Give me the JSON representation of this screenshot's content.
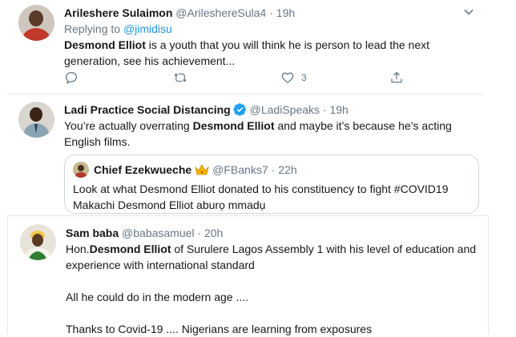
{
  "tweets": [
    {
      "name": "Arileshere Sulaimon",
      "handle": "@ArileshereSula4",
      "separator": "·",
      "time": "19h",
      "reply_prefix": "Replying to",
      "reply_to": "@jimidisu",
      "body_bold": "Desmond Elliot",
      "body_line1_rest": " is a youth that you will think he is person to lead the next",
      "body_line2": "generation, see his achievement...",
      "actions": {
        "reply_icon": "reply-icon",
        "retweet_icon": "retweet-icon",
        "like_icon": "heart-icon",
        "like_count": "3",
        "share_icon": "share-icon"
      }
    },
    {
      "name": "Ladi Practice Social Distancing",
      "handle": "@LadiSpeaks",
      "separator": "·",
      "time": "19h",
      "verified": true,
      "body_line1_pre": "You’re actually overrating ",
      "body_bold": "Desmond Elliot",
      "body_line1_post": " and maybe it’s because he’s acting",
      "body_line2": "English films.",
      "quote": {
        "name": "Chief Ezekwueche",
        "handle": "@FBanks7",
        "separator": "·",
        "time": "22h",
        "line1": "Look at what Desmond Elliot donated to his constituency to fight #COVID19",
        "line2": "Makachi Desmond Elliot aburọ mmadụ"
      }
    },
    {
      "name": "Sam baba",
      "handle": "@babasamuel",
      "separator": "·",
      "time": "20h",
      "body_pre": "Hon.",
      "body_bold": "Desmond Elliot",
      "body_line1_rest": " of Surulere Lagos Assembly 1 with his level of education and",
      "body_line2": "experience with international standard",
      "body_line3": "All he could do in the modern age ....",
      "body_line4": "Thanks to Covid-19 .... Nigerians are learning from exposures"
    }
  ],
  "colors": {
    "text": "#14171a",
    "muted": "#657786",
    "link": "#1b95e0",
    "border": "#e6ecf0",
    "verified": "#1da1f2"
  }
}
